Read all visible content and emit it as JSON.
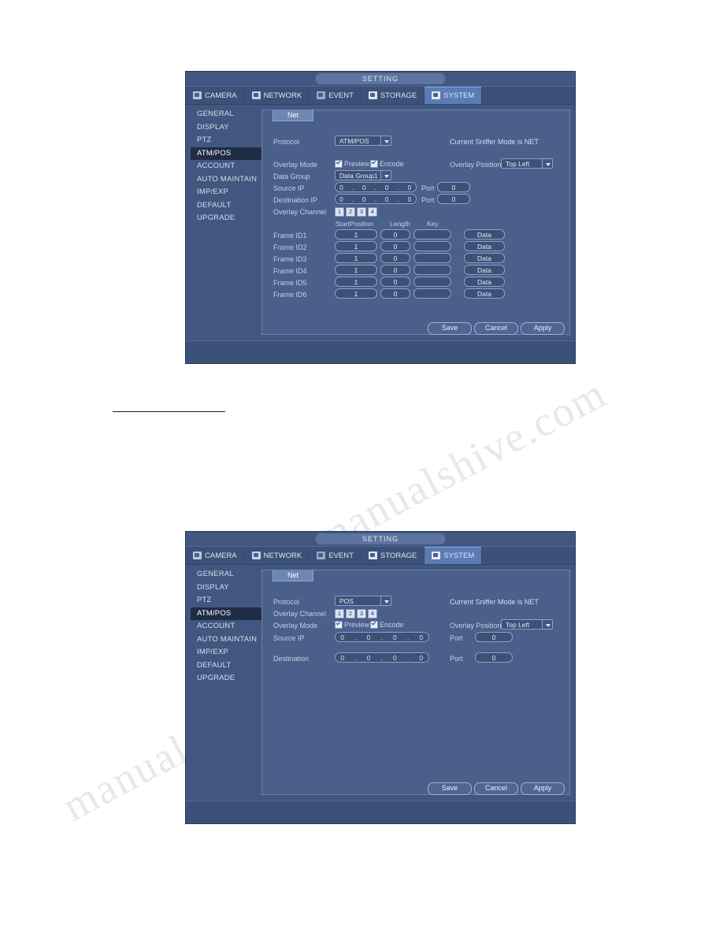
{
  "page": {
    "watermark_text": "manualshive.com",
    "divider": "horizontal-rule"
  },
  "dialogs": [
    {
      "id": "atm-pos-net",
      "title": "SETTING",
      "tabs": [
        {
          "label": "CAMERA",
          "icon": "camera-icon",
          "active": false
        },
        {
          "label": "NETWORK",
          "icon": "network-icon",
          "active": false
        },
        {
          "label": "EVENT",
          "icon": "event-icon",
          "active": false
        },
        {
          "label": "STORAGE",
          "icon": "storage-icon",
          "active": false
        },
        {
          "label": "SYSTEM",
          "icon": "system-icon",
          "active": true
        }
      ],
      "sidebar": [
        {
          "label": "GENERAL",
          "active": false
        },
        {
          "label": "DISPLAY",
          "active": false
        },
        {
          "label": "PTZ",
          "active": false
        },
        {
          "label": "ATM/POS",
          "active": true
        },
        {
          "label": "ACCOUNT",
          "active": false
        },
        {
          "label": "AUTO MAINTAIN",
          "active": false
        },
        {
          "label": "IMP/EXP",
          "active": false
        },
        {
          "label": "DEFAULT",
          "active": false
        },
        {
          "label": "UPGRADE",
          "active": false
        }
      ],
      "subtab": "Net",
      "fields": {
        "protocol_label": "Protocol",
        "protocol_value": "ATM/POS",
        "sniffer_mode": "Current Sniffer Mode is NET",
        "overlay_mode_label": "Overlay Mode",
        "preview_label": "Preview",
        "encode_label": "Encode",
        "overlay_position_label": "Overlay Position",
        "overlay_position_value": "Top Left",
        "data_group_label": "Data Group",
        "data_group_value": "Data Group1",
        "source_ip_label": "Source IP",
        "source_ip_value": [
          "0",
          "0",
          "0",
          "0"
        ],
        "source_port_label": "Port",
        "source_port_value": "0",
        "dest_ip_label": "Destination IP",
        "dest_ip_value": [
          "0",
          "0",
          "0",
          "0"
        ],
        "dest_port_label": "Port",
        "dest_port_value": "0",
        "overlay_channel_label": "Overlay Channel",
        "overlay_channels": [
          "1",
          "2",
          "3",
          "4"
        ],
        "col_startposition": "StartPosition",
        "col_length": "Length",
        "col_key": "Key",
        "data_button": "Data"
      },
      "frames": [
        {
          "label": "Frame ID1",
          "start": "1",
          "length": "0",
          "key": "",
          "button": "Data"
        },
        {
          "label": "Frame ID2",
          "start": "1",
          "length": "0",
          "key": "",
          "button": "Data"
        },
        {
          "label": "Frame ID3",
          "start": "1",
          "length": "0",
          "key": "",
          "button": "Data"
        },
        {
          "label": "Frame ID4",
          "start": "1",
          "length": "0",
          "key": "",
          "button": "Data"
        },
        {
          "label": "Frame ID5",
          "start": "1",
          "length": "0",
          "key": "",
          "button": "Data"
        },
        {
          "label": "Frame ID6",
          "start": "1",
          "length": "0",
          "key": "",
          "button": "Data"
        }
      ],
      "buttons": {
        "save": "Save",
        "cancel": "Cancel",
        "apply": "Apply"
      }
    },
    {
      "id": "pos-net",
      "title": "SETTING",
      "tabs": [
        {
          "label": "CAMERA",
          "icon": "camera-icon",
          "active": false
        },
        {
          "label": "NETWORK",
          "icon": "network-icon",
          "active": false
        },
        {
          "label": "EVENT",
          "icon": "event-icon",
          "active": false
        },
        {
          "label": "STORAGE",
          "icon": "storage-icon",
          "active": false
        },
        {
          "label": "SYSTEM",
          "icon": "system-icon",
          "active": true
        }
      ],
      "sidebar": [
        {
          "label": "GENERAL",
          "active": false
        },
        {
          "label": "DISPLAY",
          "active": false
        },
        {
          "label": "PTZ",
          "active": false
        },
        {
          "label": "ATM/POS",
          "active": true
        },
        {
          "label": "ACCOUNT",
          "active": false
        },
        {
          "label": "AUTO MAINTAIN",
          "active": false
        },
        {
          "label": "IMP/EXP",
          "active": false
        },
        {
          "label": "DEFAULT",
          "active": false
        },
        {
          "label": "UPGRADE",
          "active": false
        }
      ],
      "subtab": "Net",
      "fields": {
        "protocol_label": "Protocol",
        "protocol_value": "POS",
        "sniffer_mode": "Current Sniffer Mode is NET",
        "overlay_channel_label": "Overlay Channel",
        "overlay_channels": [
          "1",
          "2",
          "3",
          "4"
        ],
        "overlay_mode_label": "Overlay Mode",
        "preview_label": "Preview",
        "encode_label": "Encode",
        "overlay_position_label": "Overlay Position",
        "overlay_position_value": "Top Left",
        "source_ip_label": "Source IP",
        "source_ip_value": [
          "0",
          "0",
          "0",
          "0"
        ],
        "source_port_label": "Port",
        "source_port_value": "0",
        "destination_label": "Destination",
        "destination_ip_value": [
          "0",
          "0",
          "0",
          "0"
        ],
        "destination_port_label": "Port",
        "destination_port_value": "0"
      },
      "buttons": {
        "save": "Save",
        "cancel": "Cancel",
        "apply": "Apply"
      }
    }
  ]
}
